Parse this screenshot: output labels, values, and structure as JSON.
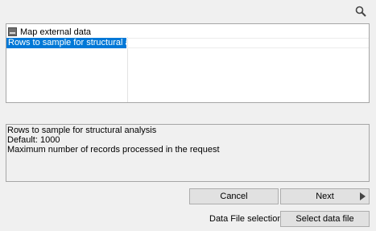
{
  "toolbar": {
    "search_icon": "search-icon"
  },
  "tree": {
    "root_label": "Map external data",
    "root_icon": "table-icon",
    "rows": [
      {
        "label": "Rows to sample for structural analysis",
        "selected": true
      }
    ]
  },
  "description": {
    "title": "Rows to sample for structural analysis",
    "default": "Default: 1000",
    "detail": "Maximum number of records processed in the request"
  },
  "buttons": {
    "cancel": "Cancel",
    "next": "Next",
    "select_file": "Select data file"
  },
  "file_selection_label": "Data File selection",
  "colors": {
    "selection": "#0078d7",
    "background": "#f0f0f0"
  }
}
